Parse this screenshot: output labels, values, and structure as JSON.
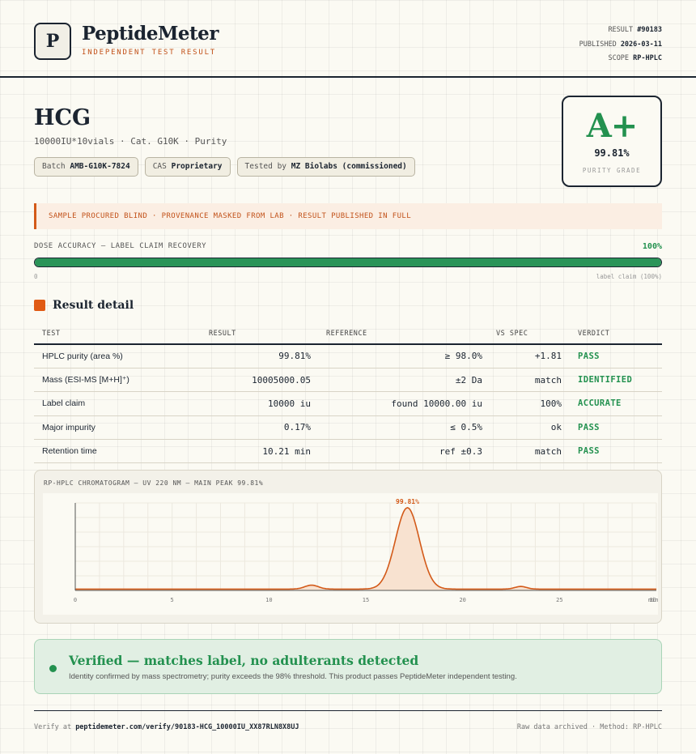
{
  "header": {
    "logo_letter": "P",
    "brand": "PeptideMeter",
    "brand_sub": "INDEPENDENT TEST RESULT",
    "meta": [
      {
        "label": "RESULT",
        "value": "#90183"
      },
      {
        "label": "PUBLISHED",
        "value": "2026-03-11"
      },
      {
        "label": "SCOPE",
        "value": "RP-HPLC"
      }
    ]
  },
  "product": {
    "name": "HCG",
    "subtitle": "10000IU*10vials · Cat. G10K · Purity",
    "chips": [
      {
        "label": "Batch",
        "value": "AMB-G10K-7824"
      },
      {
        "label": "CAS",
        "value": "Proprietary"
      },
      {
        "label": "Tested by",
        "value": "MZ Biolabs (commissioned)"
      }
    ]
  },
  "grade": {
    "letter": "A+",
    "value": "99.81%",
    "label": "PURITY GRADE",
    "color": "#23914f"
  },
  "notice": "SAMPLE PROCURED BLIND · PROVENANCE MASKED FROM LAB · RESULT PUBLISHED IN FULL",
  "dose": {
    "label": "DOSE ACCURACY — LABEL CLAIM RECOVERY",
    "value_text": "100%",
    "fill_percent": 100,
    "min_label": "0",
    "max_label": "label claim (100%)",
    "color": "#2a9458"
  },
  "section_title": "Result detail",
  "table": {
    "headers": [
      "TEST",
      "RESULT",
      "REFERENCE",
      "VS SPEC",
      "VERDICT"
    ],
    "rows": [
      {
        "test": "HPLC purity (area %)",
        "result": "99.81%",
        "reference": "≥ 98.0%",
        "vs": "+1.81",
        "verdict": "PASS"
      },
      {
        "test": "Mass (ESI-MS [M+H]⁺)",
        "result": "10005000.05",
        "reference": "±2 Da",
        "vs": "match",
        "verdict": "IDENTIFIED"
      },
      {
        "test": "Label claim",
        "result": "10000 iu",
        "reference": "found 10000.00 iu",
        "vs": "100%",
        "verdict": "ACCURATE"
      },
      {
        "test": "Major impurity",
        "result": "0.17%",
        "reference": "≤ 0.5%",
        "vs": "ok",
        "verdict": "PASS"
      },
      {
        "test": "Retention time",
        "result": "10.21 min",
        "reference": "ref ±0.3",
        "vs": "match",
        "verdict": "PASS"
      }
    ]
  },
  "chart_data": {
    "type": "line",
    "title": "RP-HPLC CHROMATOGRAM — UV 220 NM — MAIN PEAK 99.81%",
    "peak_label": "99.81%",
    "x_ticks": [
      "0",
      "5",
      "10",
      "15",
      "20",
      "25",
      "30"
    ],
    "x_unit": "min",
    "xlim": [
      0,
      30
    ],
    "ylim": [
      0,
      100
    ],
    "baseline": 1.5,
    "peaks": [
      {
        "x": 12.2,
        "height": 4.5,
        "width": 0.35
      },
      {
        "x": 17.15,
        "height": 93,
        "width": 0.62
      },
      {
        "x": 23.0,
        "height": 3,
        "width": 0.3
      }
    ],
    "line_color": "#d35a19",
    "fill_color": "#f8e2d0"
  },
  "verified": {
    "title": "Verified — matches label, no adulterants detected",
    "text": "Identity confirmed by mass spectrometry; purity exceeds the 98% threshold. This product passes PeptideMeter independent testing.",
    "color": "#23914f"
  },
  "footer": {
    "verify_prefix": "Verify at",
    "verify_url": "peptidemeter.com/verify/90183-HCG_10000IU_XX87RLN8X8UJ",
    "right": "Raw data archived · Method: RP-HPLC"
  }
}
